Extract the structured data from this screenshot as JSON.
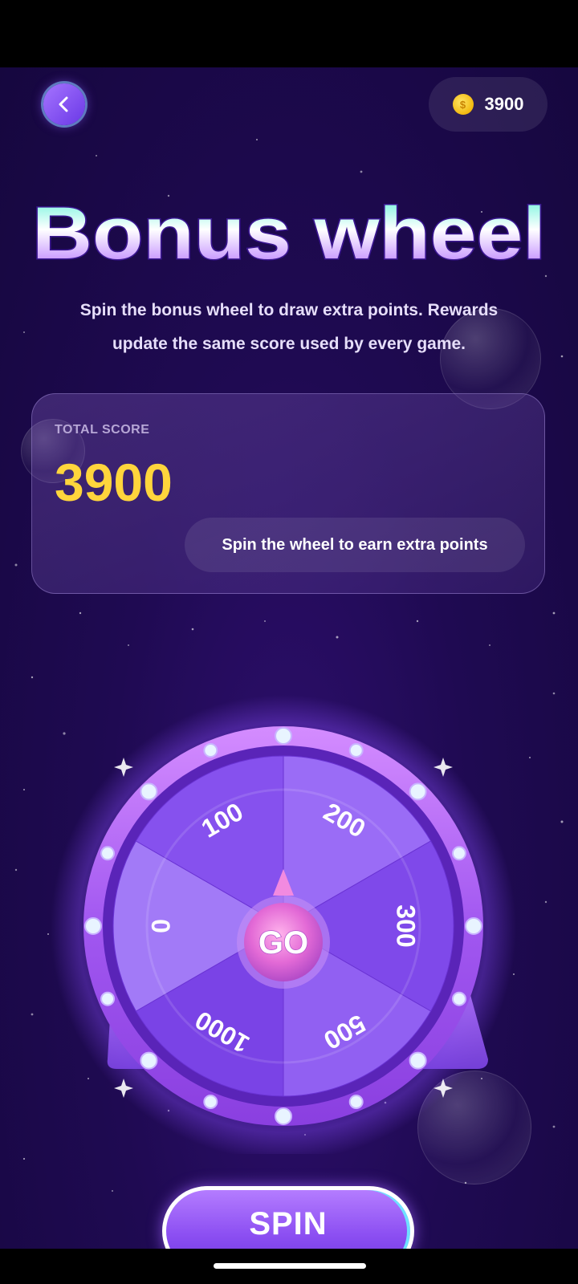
{
  "header": {
    "back_icon": "chevron-left-icon",
    "coin_icon": "coin-icon",
    "coin_symbol": "$",
    "coin_balance": "3900"
  },
  "title": "Bonus wheel",
  "subtitle_lines": [
    "Spin the bonus wheel to draw extra points. Rewards",
    "update the same score used by every game."
  ],
  "score_card": {
    "label": "TOTAL SCORE",
    "value": "3900",
    "hint": "Spin the wheel to earn extra points"
  },
  "wheel": {
    "segments": [
      "200",
      "300",
      "500",
      "1000",
      "0",
      "100"
    ],
    "center_label": "GO"
  },
  "spin_button": "SPIN",
  "colors": {
    "background": "#1f0a52",
    "score": "#ffd53c",
    "accent": "#8c4ff2",
    "title_top": "#5ef3d8",
    "title_bottom": "#b06bff"
  }
}
